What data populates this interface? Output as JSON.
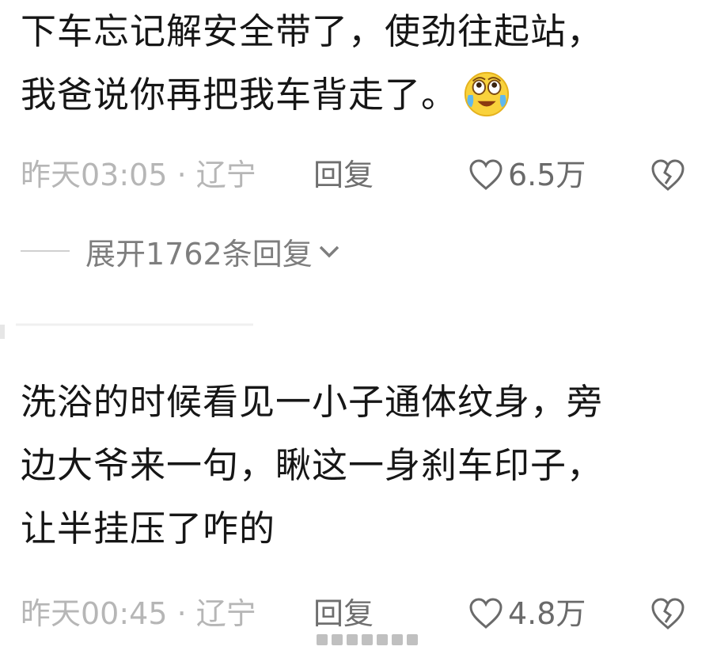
{
  "comments": [
    {
      "lines": [
        "下车忘记解安全带了，使劲往起站，",
        "我爸说你再把我车背走了。"
      ],
      "emoji": "laughing-crying-emoji",
      "time": "昨天03:05 · 辽宁",
      "reply_label": "回复",
      "likes": "6.5万",
      "expand_label": "展开1762条回复"
    },
    {
      "lines": [
        "洗浴的时候看见一小子通体纹身，旁",
        "边大爷来一句，瞅这一身刹车印子，",
        "让半挂压了咋的"
      ],
      "time": "昨天00:45 · 辽宁",
      "reply_label": "回复",
      "likes": "4.8万"
    }
  ],
  "icons": {
    "like": "heart-outline-icon",
    "dislike": "broken-heart-icon",
    "expand": "chevron-down-icon"
  },
  "colors": {
    "text": "#161616",
    "meta": "#b6b6b6",
    "reply": "#6f6f6f",
    "emoji_face": "#f9d23c"
  }
}
